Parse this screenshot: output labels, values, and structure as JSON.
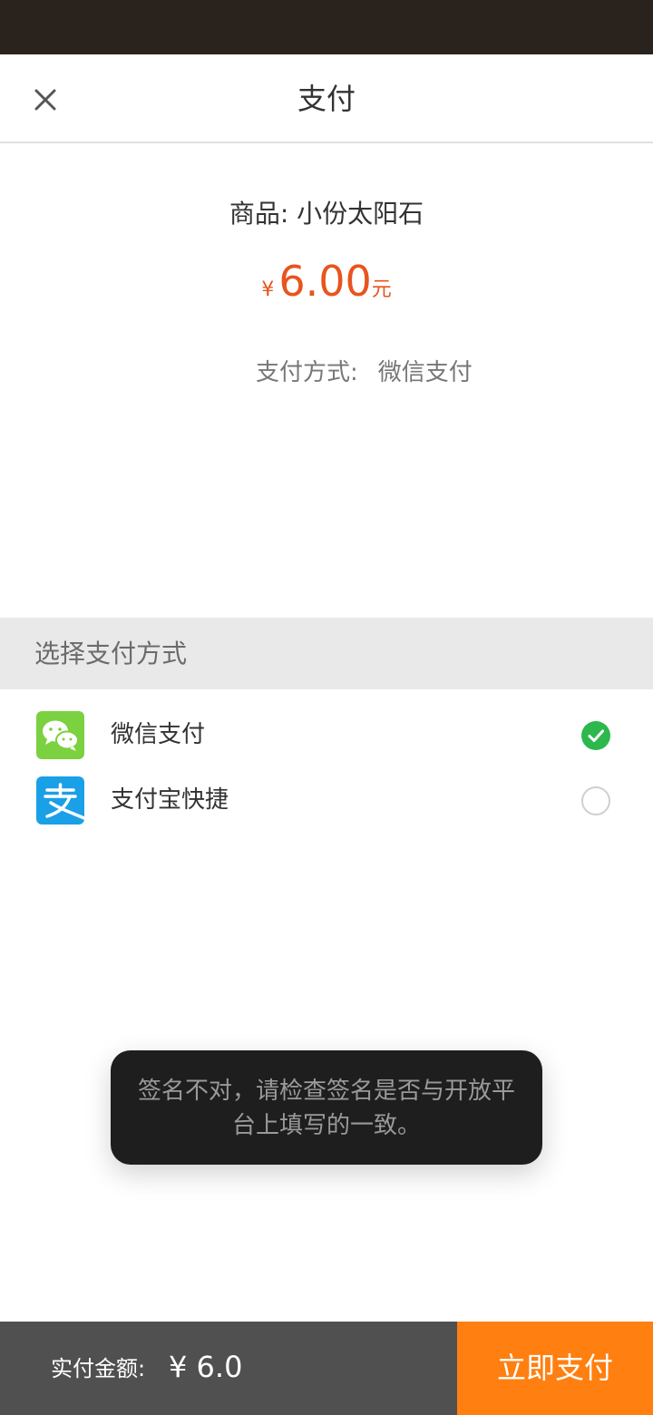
{
  "header": {
    "title": "支付",
    "close_icon": "close-icon"
  },
  "order": {
    "product_text": "商品: 小份太阳石",
    "currency_symbol": "¥",
    "amount": "6.00",
    "unit": "元",
    "method_label": "支付方式:",
    "method_value": "微信支付"
  },
  "payment_section": {
    "title": "选择支付方式",
    "options": [
      {
        "label": "微信支付",
        "icon": "wechat-pay-icon",
        "selected": true
      },
      {
        "label": "支付宝快捷",
        "icon": "alipay-icon",
        "selected": false
      }
    ]
  },
  "toast": {
    "message": "签名不对，请检查签名是否与开放平台上填写的一致。"
  },
  "footer": {
    "total_label": "实付金额:",
    "total_value": "¥ 6.0",
    "pay_button_label": "立即支付"
  },
  "colors": {
    "status_bar": "#2a221d",
    "price": "#e8541e",
    "pay_button": "#ff7f10",
    "footer_total_bg": "#505050",
    "wechat_green": "#7bd13f",
    "alipay_blue": "#1aa0e6",
    "check_green": "#2db84d"
  }
}
